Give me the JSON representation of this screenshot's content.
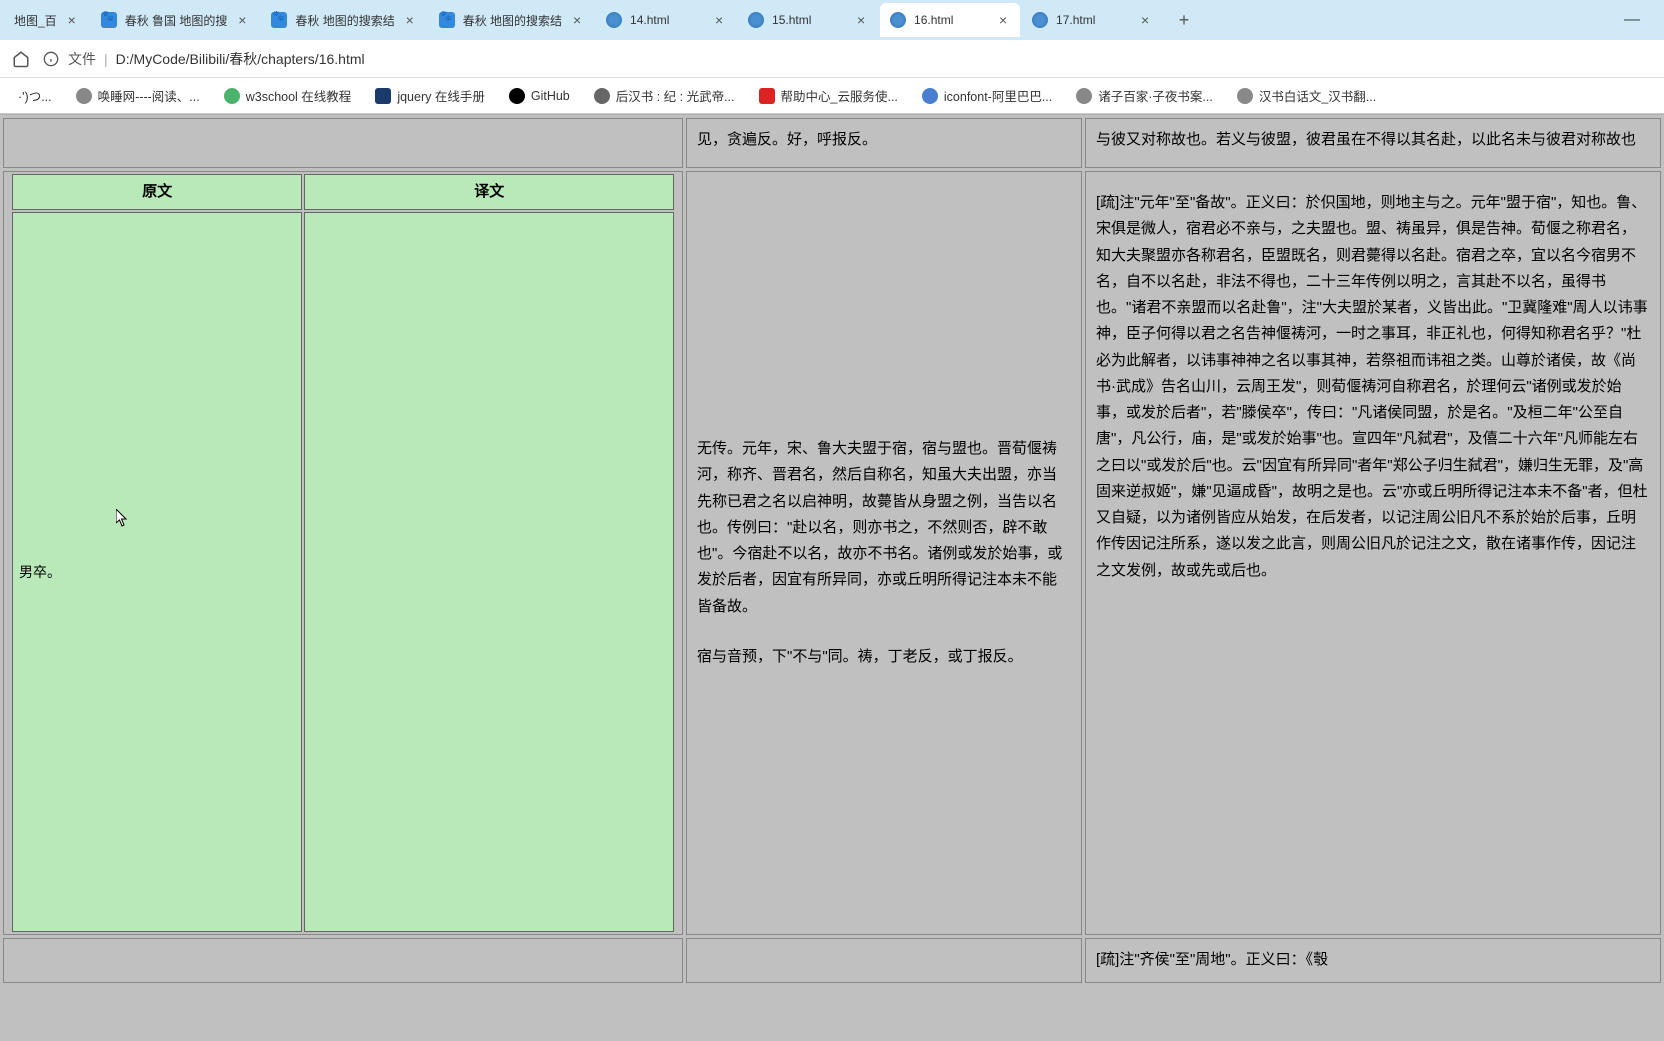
{
  "tabs": [
    {
      "title": "地图_百",
      "icon": "paw"
    },
    {
      "title": "春秋 鲁国 地图的搜",
      "icon": "paw"
    },
    {
      "title": "春秋 地图的搜索结",
      "icon": "paw"
    },
    {
      "title": "春秋 地图的搜索结",
      "icon": "paw"
    },
    {
      "title": "14.html",
      "icon": "globe"
    },
    {
      "title": "15.html",
      "icon": "globe"
    },
    {
      "title": "16.html",
      "icon": "globe",
      "active": true
    },
    {
      "title": "17.html",
      "icon": "globe"
    }
  ],
  "url": {
    "label": "文件",
    "path": "D:/MyCode/Bilibili/春秋/chapters/16.html"
  },
  "bookmarks": [
    {
      "label": "·')つ...",
      "color": "#888"
    },
    {
      "label": "唤睡网----阅读、...",
      "color": "#888"
    },
    {
      "label": "w3school 在线教程",
      "color": "#4bb36a"
    },
    {
      "label": "jquery 在线手册",
      "color": "#1a3a6a",
      "square": true
    },
    {
      "label": "GitHub",
      "color": "#000"
    },
    {
      "label": "后汉书 : 纪 : 光武帝...",
      "color": "#666"
    },
    {
      "label": "帮助中心_云服务使...",
      "color": "#d22",
      "square": true
    },
    {
      "label": "iconfont-阿里巴巴...",
      "color": "#4a7ed0"
    },
    {
      "label": "诸子百家·子夜书案...",
      "color": "#888"
    },
    {
      "label": "汉书白话文_汉书翻...",
      "color": "#888"
    }
  ],
  "document": {
    "top_mid": "见，贪遍反。好，呼报反。",
    "top_right": "与彼又对称故也。若义与彼盟，彼君虽在不得以其名赴，以此名未与彼君对称故也",
    "inner": {
      "header_left": "原文",
      "header_right": "译文",
      "row_left": "男卒。",
      "row_right": ""
    },
    "mid_text1": "无传。元年，宋、鲁大夫盟于宿，宿与盟也。晋荀偃祷河，称齐、晋君名，然后自称名，知虽大夫出盟，亦当先称已君之名以启神明，故薨皆从身盟之例，当告以名也。传例曰：\"赴以名，则亦书之，不然则否，辟不敢也\"。今宿赴不以名，故亦不书名。诸例或发於始事，或发於后者，因宜有所异同，亦或丘明所得记注本未不能皆备故。",
    "mid_text2": "宿与音预，下\"不与\"同。祷，丁老反，或丁报反。",
    "right_text": "[疏]注\"元年\"至\"备故\"。正义曰：於伿国地，则地主与之。元年\"盟于宿\"，知也。鲁、宋俱是微人，宿君必不亲与，之夫盟也。盟、祷虽异，俱是告神。荀偃之称君名，知大夫聚盟亦各称君名，臣盟既名，则君薨得以名赴。宿君之卒，宜以名今宿男不名，自不以名赴，非法不得也，二十三年传例以明之，言其赴不以名，虽得书也。\"诸君不亲盟而以名赴鲁\"，注\"大夫盟於某者，义皆出此。\"卫冀隆难\"周人以讳事神，臣子何得以君之名告神偃祷河，一时之事耳，非正礼也，何得知称君名乎？\"杜必为此解者，以讳事神神之名以事其神，若祭祖而讳祖之类。山尊於诸侯，故《尚书·武成》告名山川，云周王发\"，则荀偃祷河自称君名，於理何云\"诸例或发於始事，或发於后者\"，若\"滕侯卒\"，传曰：\"凡诸侯同盟，於是名。\"及桓二年\"公至自唐\"，凡公行，庙，是\"或发於始事\"也。宣四年\"凡弑君\"，及僖二十六年\"凡师能左右之曰以\"或发於后\"也。云\"因宜有所异同\"者年\"郑公子归生弑君\"，嫌归生无罪，及\"高固来逆叔姬\"，嫌\"见逼成昏\"，故明之是也。云\"亦或丘明所得记注本未不备\"者，但杜又自疑，以为诸例皆应从始发，在后发者，以记注周公旧凡不系於始於后事，丘明作传因记注所系，遂以发之此言，则周公旧凡於记注之文，散在诸事作传，因记注之文发例，故或先或后也。",
    "bot_right": "[疏]注\"齐侯\"至\"周地\"。正义曰：《彀"
  }
}
